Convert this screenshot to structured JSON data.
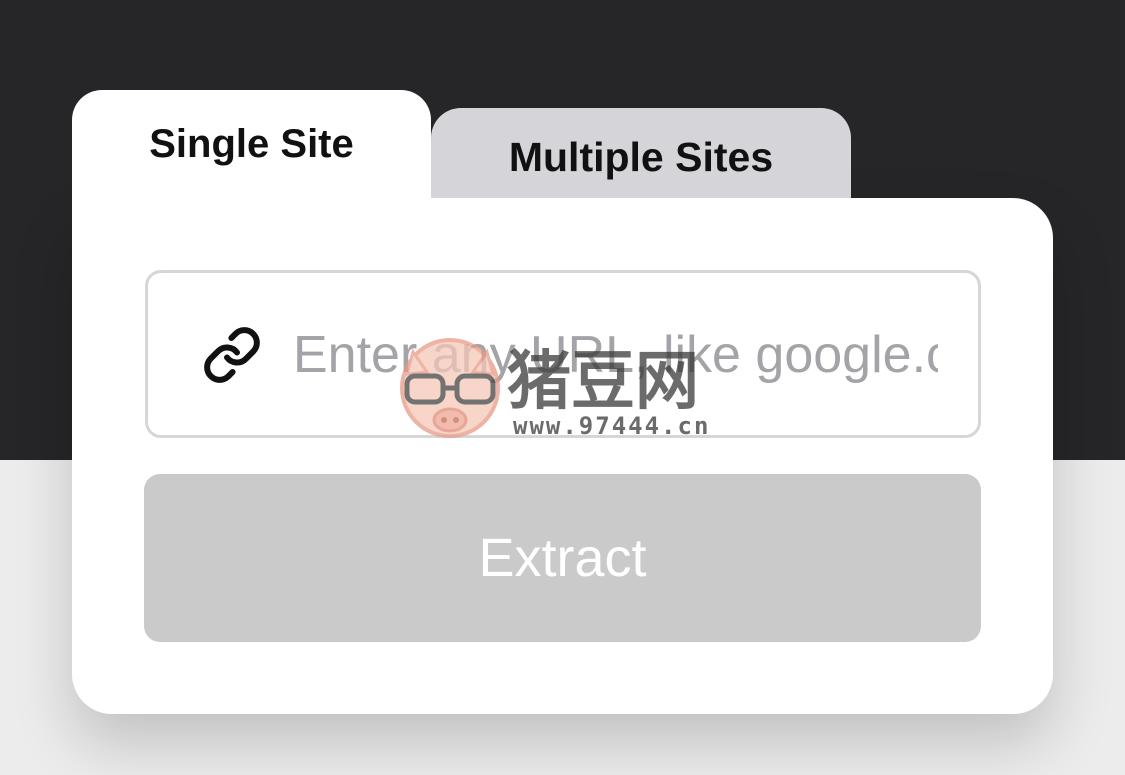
{
  "tabs": {
    "single_label": "Single Site",
    "multiple_label": "Multiple Sites",
    "active": "Single Site"
  },
  "input": {
    "placeholder": "Enter any URL, like google.com",
    "value": "",
    "icon": "link-icon"
  },
  "action": {
    "extract_label": "Extract",
    "enabled": false
  },
  "watermark": {
    "text": "猪豆网",
    "url": "www.97444.cn"
  },
  "colors": {
    "dark_background": "#262628",
    "light_background": "#ececec",
    "card": "#ffffff",
    "inactive_tab": "#d5d5d9",
    "button_disabled": "#cacaca",
    "placeholder": "#a4a4a8"
  }
}
